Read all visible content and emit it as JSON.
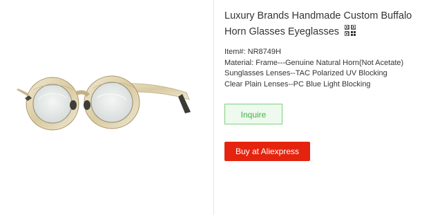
{
  "product": {
    "image_alt": "round horn glasses",
    "title": "Luxury Brands Handmade Custom Buffalo Horn Glasses Eyeglasses",
    "qr_icon": "qr-code-icon",
    "item_number": "Item#: NR8749H",
    "material": "Material: Frame---Genuine Natural Horn(Not Acetate)",
    "sunglasses_lenses": "Sunglasses Lenses--TAC Polarized UV Blocking",
    "clear_lenses": "Clear Plain Lenses--PC Blue Light Blocking"
  },
  "actions": {
    "inquire_label": "Inquire",
    "buy_label": "Buy at Aliexpress"
  },
  "colors": {
    "buy_button": "#e4240f",
    "inquire_text": "#44b044",
    "inquire_border": "#7fd07f"
  }
}
